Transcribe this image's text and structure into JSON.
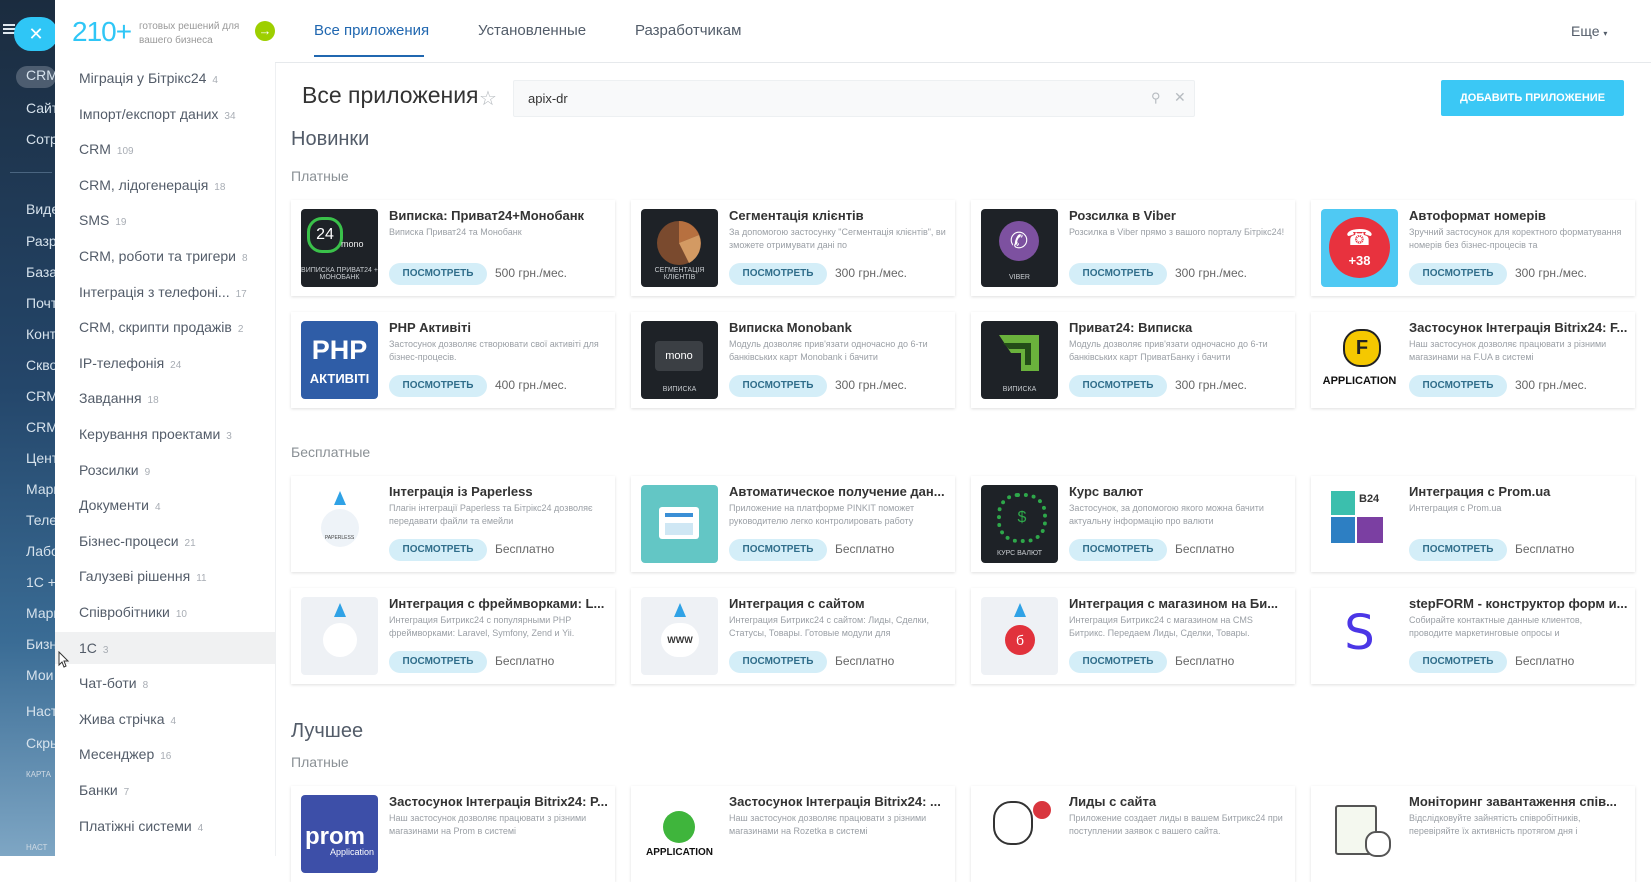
{
  "left_edge": {
    "items": [
      "CRM",
      "Сайт",
      "Сотр",
      "Видео",
      "Разр",
      "База",
      "Почт",
      "Конт",
      "Скво",
      "CRM",
      "CRM",
      "Цент",
      "Марк",
      "Теле",
      "Лабо",
      "1С +",
      "Марк",
      "Бизн",
      "Мои",
      "Наст",
      "Скры"
    ],
    "small_labels": [
      "КАРТА",
      "НАСТ"
    ]
  },
  "promo": {
    "big": "210+",
    "small": "готовых решений для вашего бизнеса"
  },
  "categories": [
    {
      "label": "Міграція у Бітрікс24",
      "count": "4"
    },
    {
      "label": "Імпорт/експорт даних",
      "count": "34"
    },
    {
      "label": "CRM",
      "count": "109"
    },
    {
      "label": "CRM, лідогенерація",
      "count": "18"
    },
    {
      "label": "SMS",
      "count": "19"
    },
    {
      "label": "CRM, роботи та тригери",
      "count": "8"
    },
    {
      "label": "Інтеграція з телефоні...",
      "count": "17"
    },
    {
      "label": "CRM, скрипти продажів",
      "count": "2"
    },
    {
      "label": "IP-телефонія",
      "count": "24"
    },
    {
      "label": "Завдання",
      "count": "18"
    },
    {
      "label": "Керування проектами",
      "count": "3"
    },
    {
      "label": "Розсилки",
      "count": "9"
    },
    {
      "label": "Документи",
      "count": "4"
    },
    {
      "label": "Бізнес-процеси",
      "count": "21"
    },
    {
      "label": "Галузеві рішення",
      "count": "11"
    },
    {
      "label": "Співробітники",
      "count": "10"
    },
    {
      "label": "1С",
      "count": "3"
    },
    {
      "label": "Чат-боти",
      "count": "8"
    },
    {
      "label": "Жива стрічка",
      "count": "4"
    },
    {
      "label": "Месенджер",
      "count": "16"
    },
    {
      "label": "Банки",
      "count": "7"
    },
    {
      "label": "Платіжні системи",
      "count": "4"
    }
  ],
  "tabs": [
    "Все приложения",
    "Установленные",
    "Разработчикам"
  ],
  "more_label": "Еще",
  "page_title": "Все приложения",
  "search": {
    "value": "apix-dr"
  },
  "add_button": "ДОБАВИТЬ ПРИЛОЖЕНИЕ",
  "sections": {
    "new_title": "Новинки",
    "paid_label": "Платные",
    "free_label": "Бесплатные",
    "best_title": "Лучшее",
    "best_paid_label": "Платные"
  },
  "view_label": "ПОСМОТРЕТЬ",
  "paid_cards": [
    {
      "title": "Виписка: Приват24+Монобанк",
      "desc": "Виписка Приват24 та Монобанк",
      "price": "500 грн./мес.",
      "thumb": "24 mono",
      "thumb_sub": "ВИПИСКА ПРИВАТ24 + МОНОБАНК"
    },
    {
      "title": "Сегментація клієнтів",
      "desc": "За допомогою застосунку \"Сегментація клієнтів\", ви зможете отримувати дані по",
      "price": "300 грн./мес.",
      "thumb": "",
      "thumb_sub": "СЕГМЕНТАЦІЯ КЛІЄНТІВ"
    },
    {
      "title": "Розсилка в Viber",
      "desc": "Розсилка в Viber прямо з вашого порталу Бітрікс24!",
      "price": "300 грн./мес.",
      "thumb": "",
      "thumb_sub": "VIBER"
    },
    {
      "title": "Автоформат номерів",
      "desc": "Зручний застосунок для коректного форматування номерів без бізнес-процесів та",
      "price": "300 грн./мес.",
      "thumb": "+38",
      "thumb_sub": ""
    },
    {
      "title": "PHP Активіті",
      "desc": "Застосунок дозволяє створювати свої активіті для бізнес-процесів.",
      "price": "400 грн./мес.",
      "thumb": "PHP",
      "thumb_sub": "АКТИВІТІ"
    },
    {
      "title": "Виписка Monobank",
      "desc": "Модуль дозволяє прив'язати одночасно до 6-ти банківських карт Monobank і бачити",
      "price": "300 грн./мес.",
      "thumb": "mono",
      "thumb_sub": "ВИПИСКА"
    },
    {
      "title": "Приват24: Виписка",
      "desc": "Модуль дозволяє прив'язати одночасно до 6-ти банківських карт ПриватБанку і бачити",
      "price": "300 грн./мес.",
      "thumb": "",
      "thumb_sub": "ВИПИСКА"
    },
    {
      "title": "Застосунок Інтеграція Bitrix24: F...",
      "desc": "Наш застосунок дозволяє працювати з різними магазинами на F.UA в системі",
      "price": "300 грн./мес.",
      "thumb": "F",
      "thumb_sub": "APPLICATION"
    }
  ],
  "free_cards": [
    {
      "title": "Інтеграція із Paperless",
      "desc": "Плагін інтеграції Paperless та Бітрікс24 дозволяє передавати файли та емейли",
      "price": "Бесплатно",
      "thumb": "PAPERLESS"
    },
    {
      "title": "Автоматическое получение дан...",
      "desc": "Приложение на платформе PINKIT поможет руководителю легко контролировать работу",
      "price": "Бесплатно",
      "thumb": ""
    },
    {
      "title": "Курс валют",
      "desc": "Застосунок, за допомогою якого можна бачити актуальну інформацію про валюти",
      "price": "Бесплатно",
      "thumb": "КУРС ВАЛЮТ"
    },
    {
      "title": "Интеграция с Prom.ua",
      "desc": "Интеграция с Prom.ua",
      "price": "Бесплатно",
      "thumb": "B24"
    },
    {
      "title": "Интеграция с фреймворками: L...",
      "desc": "Интеграция Битрикс24 с популярными PHP фреймворками: Laravel, Symfony, Zend и Yii.",
      "price": "Бесплатно",
      "thumb": ""
    },
    {
      "title": "Интеграция с сайтом",
      "desc": "Интеграция Битрикс24 с сайтом: Лиды, Сделки, Статусы, Товары. Готовые модули для",
      "price": "Бесплатно",
      "thumb": "WWW"
    },
    {
      "title": "Интеграция с магазином на Би...",
      "desc": "Интеграция Битрикс24 с магазином на CMS Битрикс. Передаем Лиды, Сделки, Товары.",
      "price": "Бесплатно",
      "thumb": ""
    },
    {
      "title": "stepFORM - конструктор форм и...",
      "desc": "Собирайте контактные данные клиентов, проводите маркетинговые опросы и",
      "price": "Бесплатно",
      "thumb": "S"
    }
  ],
  "best_cards": [
    {
      "title": "Застосунок Інтеграція Bitrix24: P...",
      "desc": "Наш застосунок дозволяє працювати з різними магазинами на Prom в системі",
      "thumb": "prom",
      "thumb_sub": "Application"
    },
    {
      "title": "Застосунок Інтеграція Bitrix24: ...",
      "desc": "Наш застосунок дозволяє працювати з різними магазинами на Rozetka в системі",
      "thumb": "",
      "thumb_sub": "APPLICATION"
    },
    {
      "title": "Лиды с сайта",
      "desc": "Приложение создает лиды в вашем Битрикс24 при поступлении заявок с вашего сайта.",
      "thumb": "",
      "thumb_sub": ""
    },
    {
      "title": "Моніторинг завантаження спів...",
      "desc": "Відслідковуйте зайнятість співробітників, перевіряйте їх активність протягом дня і",
      "thumb": "",
      "thumb_sub": ""
    }
  ],
  "colors": {
    "accent": "#2fc6f6",
    "tab_active": "#2067b0",
    "view_btn_bg": "#d4eef8"
  }
}
